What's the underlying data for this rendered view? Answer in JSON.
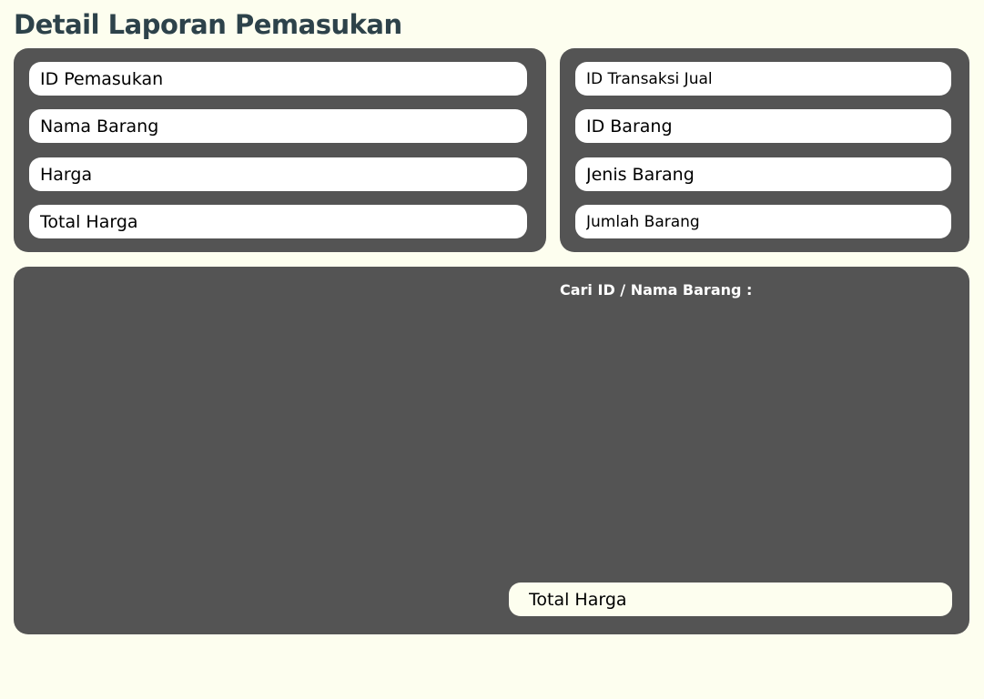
{
  "page": {
    "title": "Detail Laporan Pemasukan"
  },
  "left_panel": {
    "fields": [
      {
        "placeholder": "ID Pemasukan",
        "value": ""
      },
      {
        "placeholder": "Nama Barang",
        "value": ""
      },
      {
        "placeholder": "Harga",
        "value": ""
      },
      {
        "placeholder": "Total Harga",
        "value": ""
      }
    ]
  },
  "right_panel": {
    "fields": [
      {
        "placeholder": "ID Transaksi Jual",
        "value": ""
      },
      {
        "placeholder": "ID Barang",
        "value": ""
      },
      {
        "placeholder": "Jenis Barang",
        "value": ""
      },
      {
        "placeholder": "Jumlah Barang",
        "value": ""
      }
    ]
  },
  "bottom_panel": {
    "search_label": "Cari ID / Nama Barang :",
    "total_field": {
      "placeholder": "Total Harga",
      "value": ""
    }
  },
  "colors": {
    "background": "#fdfeef",
    "panel": "#545454",
    "title": "#2d424a",
    "field": "#ffffff"
  }
}
